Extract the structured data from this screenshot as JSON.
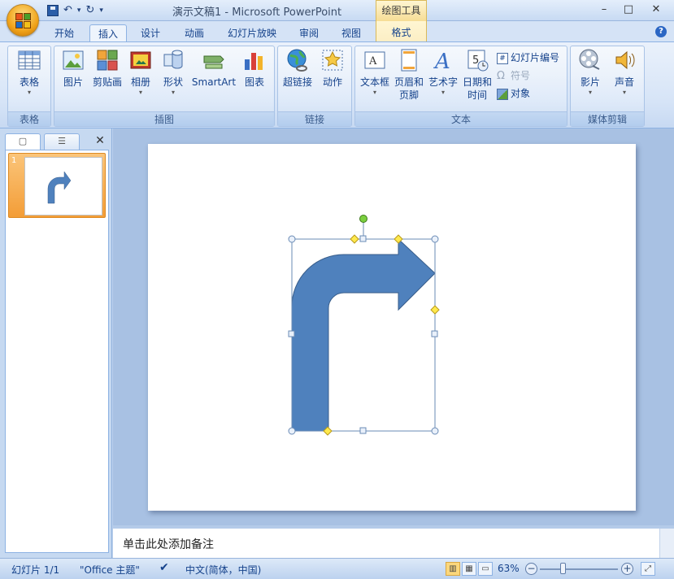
{
  "window": {
    "title": "演示文稿1 - Microsoft PowerPoint",
    "context_tool_title": "绘图工具",
    "controls": {
      "minimize": "–",
      "maximize": "□",
      "close": "✕"
    }
  },
  "qat": {
    "undo": "↶",
    "redo": "↻",
    "dropdown": "▾",
    "sep": "▾"
  },
  "tabs": [
    {
      "label": "开始"
    },
    {
      "label": "插入"
    },
    {
      "label": "设计"
    },
    {
      "label": "动画"
    },
    {
      "label": "幻灯片放映"
    },
    {
      "label": "审阅"
    },
    {
      "label": "视图"
    },
    {
      "label": "格式"
    }
  ],
  "help": "?",
  "ribbon": {
    "groups": {
      "table": {
        "label": "表格",
        "buttons": [
          "表格"
        ]
      },
      "illustrations": {
        "label": "插图",
        "buttons": [
          "图片",
          "剪贴画",
          "相册",
          "形状",
          "SmartArt",
          "图表"
        ]
      },
      "links": {
        "label": "链接",
        "buttons": [
          "超链接",
          "动作"
        ]
      },
      "text": {
        "label": "文本",
        "buttons": [
          "文本框",
          "页眉和",
          "页脚",
          "艺术字",
          "日期和",
          "时间"
        ],
        "small": [
          "幻灯片编号",
          "符号",
          "对象"
        ]
      },
      "media": {
        "label": "媒体剪辑",
        "buttons": [
          "影片",
          "声音"
        ]
      }
    },
    "dropdown_arrow": "▾"
  },
  "left_pane": {
    "close": "✕",
    "slide_number": "1"
  },
  "notes": {
    "placeholder": "单击此处添加备注"
  },
  "status": {
    "slide": "幻灯片 1/1",
    "theme": "\"Office 主题\"",
    "language": "中文(简体，中国)",
    "zoom": "63%",
    "zoom_minus": "−",
    "zoom_plus": "+"
  },
  "colors": {
    "shape_fill": "#4f81bd",
    "shape_stroke": "#385d8a",
    "selection": "#6a8bb5",
    "adjust_handle": "#ffe94d",
    "rotate_handle": "#7bcf3f"
  }
}
